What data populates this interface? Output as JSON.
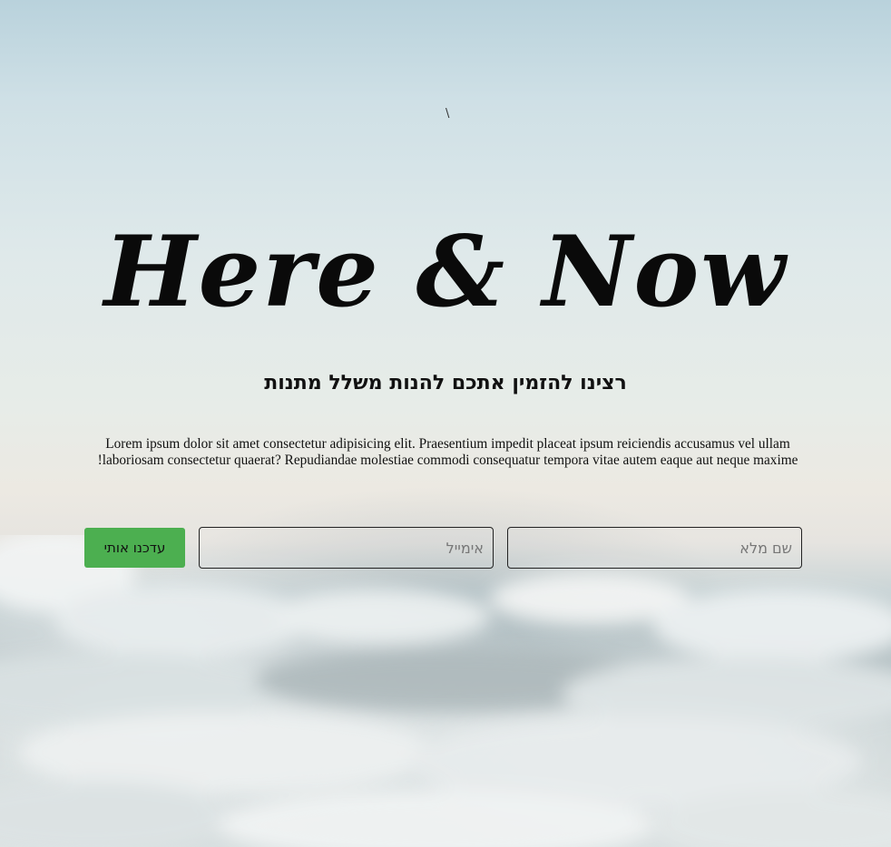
{
  "page": {
    "corner_glyph": "\\",
    "title": "Here & Now",
    "subtitle": "רצינו להזמין אתכם להנות משלל מתנות",
    "description": "Lorem ipsum dolor sit amet consectetur adipisicing elit. Praesentium impedit placeat ipsum reiciendis accusamus vel ullam laboriosam consectetur quaerat? Repudiandae molestiae commodi consequatur tempora vitae autem eaque aut neque maxime!"
  },
  "form": {
    "submit_label": "עדכנו אותי",
    "email_placeholder": "אימייל",
    "email_value": "",
    "name_placeholder": "שם מלא",
    "name_value": ""
  },
  "colors": {
    "button": "#4caf50",
    "text": "#111111"
  },
  "icons": {
    "background": "clouds-background-image"
  }
}
